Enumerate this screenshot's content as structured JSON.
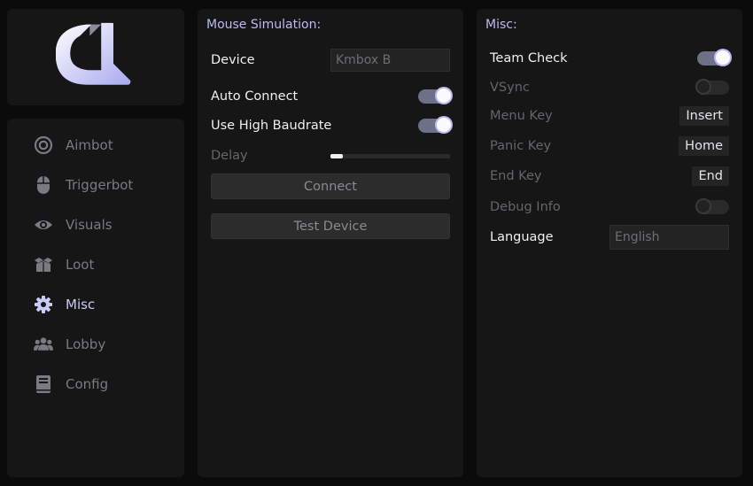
{
  "nav": {
    "items": [
      {
        "label": "Aimbot",
        "icon": "target-icon"
      },
      {
        "label": "Triggerbot",
        "icon": "mouse-icon"
      },
      {
        "label": "Visuals",
        "icon": "eye-icon"
      },
      {
        "label": "Loot",
        "icon": "box-icon"
      },
      {
        "label": "Misc",
        "icon": "gear-icon"
      },
      {
        "label": "Lobby",
        "icon": "users-icon"
      },
      {
        "label": "Config",
        "icon": "book-icon"
      }
    ],
    "active": "Misc"
  },
  "mouse": {
    "title": "Mouse Simulation:",
    "device_label": "Device",
    "device_placeholder": "Kmbox B",
    "auto_connect_label": "Auto Connect",
    "auto_connect_on": true,
    "high_baud_label": "Use High Baudrate",
    "high_baud_on": true,
    "delay_label": "Delay",
    "delay_value": 0.1,
    "connect_label": "Connect",
    "test_label": "Test Device"
  },
  "misc": {
    "title": "Misc:",
    "team_check_label": "Team Check",
    "team_check_on": true,
    "vsync_label": "VSync",
    "vsync_on": false,
    "menu_key_label": "Menu Key",
    "menu_key_value": "Insert",
    "panic_key_label": "Panic Key",
    "panic_key_value": "Home",
    "end_key_label": "End Key",
    "end_key_value": "End",
    "debug_label": "Debug Info",
    "debug_on": false,
    "language_label": "Language",
    "language_placeholder": "English"
  },
  "colors": {
    "accent": "#b9bbf2",
    "toggle_on": "#6e7088",
    "panel": "#161616",
    "background": "#0b0b0b"
  }
}
